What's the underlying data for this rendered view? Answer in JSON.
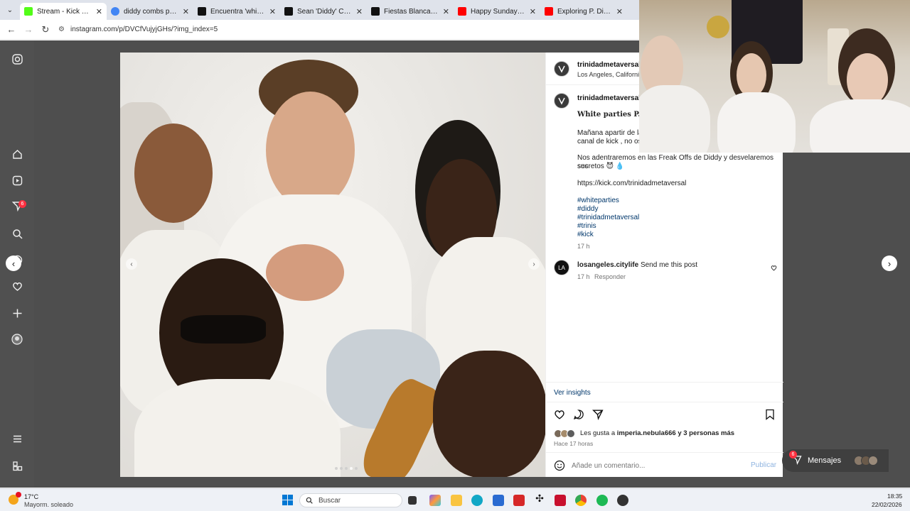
{
  "browser": {
    "tabs": [
      {
        "title": "Stream - Kick Dashbo",
        "color": "#53fc18"
      },
      {
        "title": "diddy combs parties",
        "color": "#4285f4"
      },
      {
        "title": "Encuentra 'white part",
        "color": "#111111"
      },
      {
        "title": "Sean 'Diddy' Combs",
        "color": "#111111"
      },
      {
        "title": "Fiestas Blancas de P",
        "color": "#111111"
      },
      {
        "title": "Happy Sunday to all!",
        "color": "#ff0000"
      },
      {
        "title": "Exploring P. Diddy's",
        "color": "#ff0000"
      }
    ],
    "close_glyph": "✕",
    "url": "instagram.com/p/DVCfVujyjGHs/?img_index=5"
  },
  "post": {
    "username": "trinidadmetaversal",
    "location": "Los Angeles, California",
    "caption_title": "White parties P. Did",
    "caption_line1": "Mañana apartir de las",
    "caption_line2": "canal de kick , no os l",
    "caption_line3": "Nos adentraremos en las Freak Offs de Diddy y desvelaremos sus",
    "caption_line4": "secretos 😈 💧",
    "link": "https://kick.com/trinidadmetaversal",
    "hashtags": [
      "#whiteparties",
      "#diddy",
      "#trinidadmetaversal",
      "#trinis",
      "#kick"
    ],
    "time": "17 h",
    "comment": {
      "avatar_text": "LA",
      "user": "losangeles.citylife",
      "text": "Send me this post",
      "time": "17 h",
      "reply": "Responder"
    },
    "insights": "Ver insights",
    "likes_prefix": "Les gusta a",
    "likes_user": "imperia.nebula666",
    "likes_suffix": "y 3 personas más",
    "posted": "Hace 17 horas",
    "comment_placeholder": "Añade un comentario...",
    "publish": "Publicar"
  },
  "messages": {
    "label": "Mensajes",
    "badge": "6"
  },
  "rail": {
    "notifications_badge": "6"
  },
  "taskbar": {
    "weather_temp": "17°C",
    "weather_desc": "Mayorm. soleado",
    "search": "Buscar",
    "time": "18:35",
    "date": "22/02/2026"
  }
}
